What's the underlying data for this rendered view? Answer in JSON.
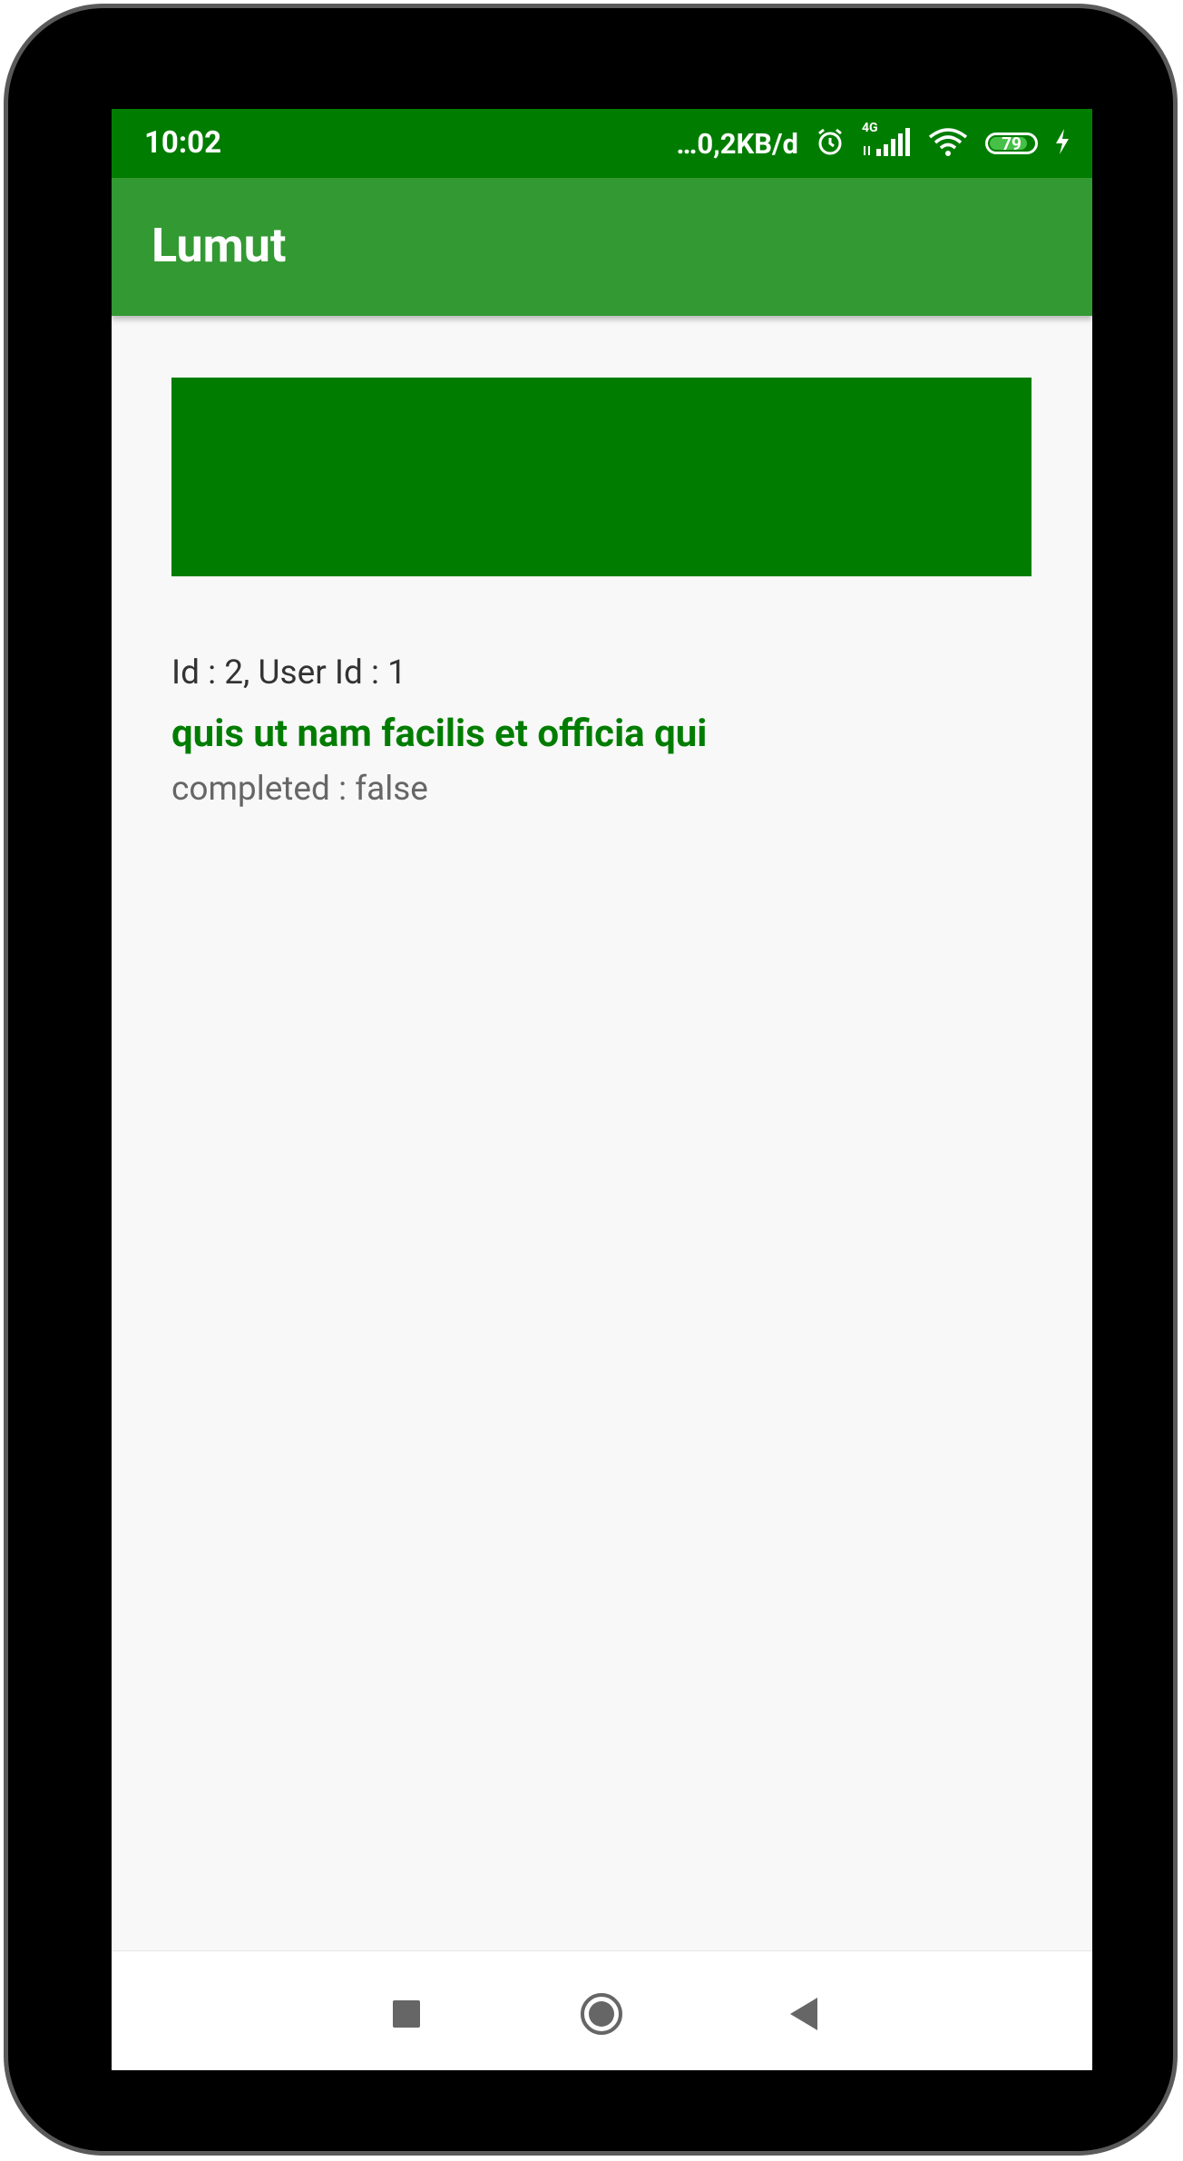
{
  "status_bar": {
    "time": "10:02",
    "net_speed": "…0,2KB/d",
    "network": "4G",
    "battery_level": "79",
    "icons": [
      "alarm-icon",
      "signal-icon",
      "wifi-icon",
      "battery-icon",
      "charging-icon"
    ]
  },
  "app_bar": {
    "title": "Lumut"
  },
  "banner": {
    "color": "#007d00"
  },
  "todo": {
    "ids_line": "Id : 2, User Id : 1",
    "title": "quis ut nam facilis et officia qui",
    "completed_line": "completed : false"
  },
  "nav_bar": {
    "icons": [
      "recents-square-icon",
      "home-circle-icon",
      "back-triangle-icon"
    ]
  },
  "colors": {
    "status_bar": "#007d00",
    "app_bar": "#339933",
    "accent_text": "#007d00",
    "background": "#f8f8f8"
  }
}
